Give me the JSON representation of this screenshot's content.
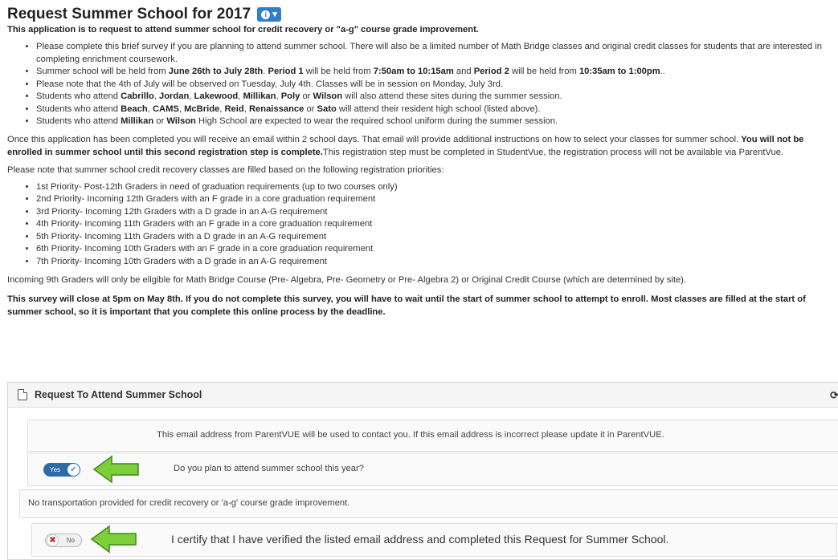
{
  "header": {
    "title": "Request Summer School for 2017",
    "info_icon": "info-circle-icon",
    "dropdown_icon": "caret-down-icon",
    "intro": "This application is to request to attend summer school for credit recovery or \"a-g\" course grade improvement."
  },
  "bullets": [
    {
      "text": "Please complete this brief survey if you are planning to attend summer school. There will also be a limited number of Math Bridge classes and original credit classes for students that are interested in completing enrichment coursework."
    },
    {
      "a": "Summer school will be held from ",
      "b": "June 26th to July 28th",
      "c": ". ",
      "d": "Period 1",
      "e": " will be held from ",
      "f": "7:50am to 10:15am",
      "g": " and ",
      "h": "Period 2",
      "i": " will be held from ",
      "j": "10:35am to 1:00pm",
      "k": ".."
    },
    {
      "text": "Please note that the 4th of July will be observed on Tuesday, July 4th. Classes will be in session on Monday, July 3rd."
    },
    {
      "a": "Students who attend ",
      "b": "Cabrillo",
      "c": ", ",
      "d": "Jordan",
      "e": ", ",
      "f": "Lakewood",
      "g": ", ",
      "h": "Millikan",
      "i": ", ",
      "j": "Poly",
      "k": " or ",
      "l": "Wilson",
      "m": " will also attend these sites during the summer session."
    },
    {
      "a": "Students who attend ",
      "b": "Beach",
      "c": ", ",
      "d": "CAMS",
      "e": ", ",
      "f": "McBride",
      "g": ", ",
      "h": "Reid",
      "i": ", ",
      "j": "Renaissance",
      "k": " or ",
      "l": "Sato",
      "m": " will attend their resident high school (listed above)."
    },
    {
      "a": "Students who attend ",
      "b": "Millikan",
      "c": " or ",
      "d": "Wilson",
      "e": " High School are expected to wear the required school uniform during the summer session."
    }
  ],
  "para1": {
    "a": "Once this application has been completed you will receive an email within 2 school days. That email will provide additional instructions on how to select your classes for summer school.",
    "b": "You will not be enrolled in summer school until this second registration step is complete.",
    "c": "This registration step must be completed in StudentVue, the registration process will not be available via ParentVue."
  },
  "para2": "Please note that summer school credit recovery classes are filled based on the following registration priorities:",
  "priorities": [
    "1st Priority- Post-12th Graders in need of graduation requirements (up to two courses only)",
    "2nd Priority- Incoming 12th Graders with an F grade in a core graduation requirement",
    "3rd Priority- Incoming 12th Graders with a D grade in an A-G requirement",
    "4th Priority- Incoming 11th Graders with an F grade in a core graduation requirement",
    "5th Priority- Incoming 11th Graders with a D grade in an A-G requirement",
    "6th Priority- Incoming 10th Graders with an F grade in a core graduation requirement",
    "7th Priority- Incoming 10th Graders with a D grade in an A-G requirement"
  ],
  "para3": "Incoming 9th Graders will only be eligible for Math Bridge Course (Pre- Algebra, Pre- Geometry or Pre- Algebra 2) or Original Credit Course (which are determined by site).",
  "para4": "This survey will close at 5pm on May 8th. If you do not complete this survey, you will have to wait until the start of summer school to attempt to enroll. Most classes are filled at the start of summer school, so it is important that you complete this online process by the deadline.",
  "panel": {
    "title": "Request To Attend Summer School",
    "doc_icon": "document-icon",
    "refresh_icon": "refresh-icon",
    "email_note": "This email address from ParentVUE will be used to contact you. If this email address is incorrect please update it in ParentVUE.",
    "q_attend": "Do you plan to attend summer school this year?",
    "q_attend_toggle": "Yes",
    "transport_note": "No transportation provided for credit recovery or 'a-g' course grade improvement.",
    "q_certify": "I certify that I have verified the listed email address and completed this Request for Summer School.",
    "q_certify_toggle": "No"
  },
  "colors": {
    "accent": "#2f7fd0",
    "toggle_on": "#2c6aa8",
    "arrow_fill": "#7ccf3a",
    "arrow_stroke": "#3f8a1a",
    "no_mark": "#c9302c"
  }
}
